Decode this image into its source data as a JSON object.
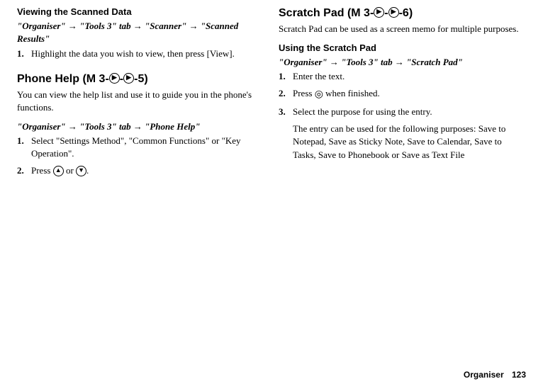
{
  "left": {
    "scanned": {
      "heading": "Viewing the Scanned Data",
      "breadcrumb": {
        "a": "\"Organiser\"",
        "b": "\"Tools 3\" tab",
        "c": "\"Scanner\"",
        "d": "\"Scanned Results\""
      },
      "step1": "Highlight the data you wish to view, then press [View]."
    },
    "phonehelp": {
      "title_prefix": "Phone Help ",
      "menu_open": "(M 3-",
      "menu_close": "-5)",
      "intro": "You can view the help list and use it to guide you in the phone's functions.",
      "breadcrumb": {
        "a": "\"Organiser\"",
        "b": "\"Tools 3\" tab",
        "c": "\"Phone Help\""
      },
      "step1": "Select \"Settings Method\", \"Common Functions\" or \"Key Operation\".",
      "step2_a": "Press ",
      "step2_b": " or ",
      "step2_c": "."
    }
  },
  "right": {
    "scratch": {
      "title_prefix": "Scratch Pad ",
      "menu_open": "(M 3-",
      "menu_close": "-6)",
      "intro": "Scratch Pad can be used as a screen memo for multiple purposes.",
      "using_heading": "Using the Scratch Pad",
      "breadcrumb": {
        "a": "\"Organiser\"",
        "b": "\"Tools 3\" tab",
        "c": "\"Scratch Pad\""
      },
      "step1": "Enter the text.",
      "step2_a": "Press ",
      "step2_b": " when finished.",
      "step3": "Select the purpose for using the entry.",
      "note": "The entry can be used for the following purposes: Save to Notepad, Save as Sticky Note, Save to Calendar, Save to Tasks, Save to Phonebook or Save as Text File"
    }
  },
  "footer": {
    "label": "Organiser",
    "page": "123"
  },
  "arrow": "→"
}
